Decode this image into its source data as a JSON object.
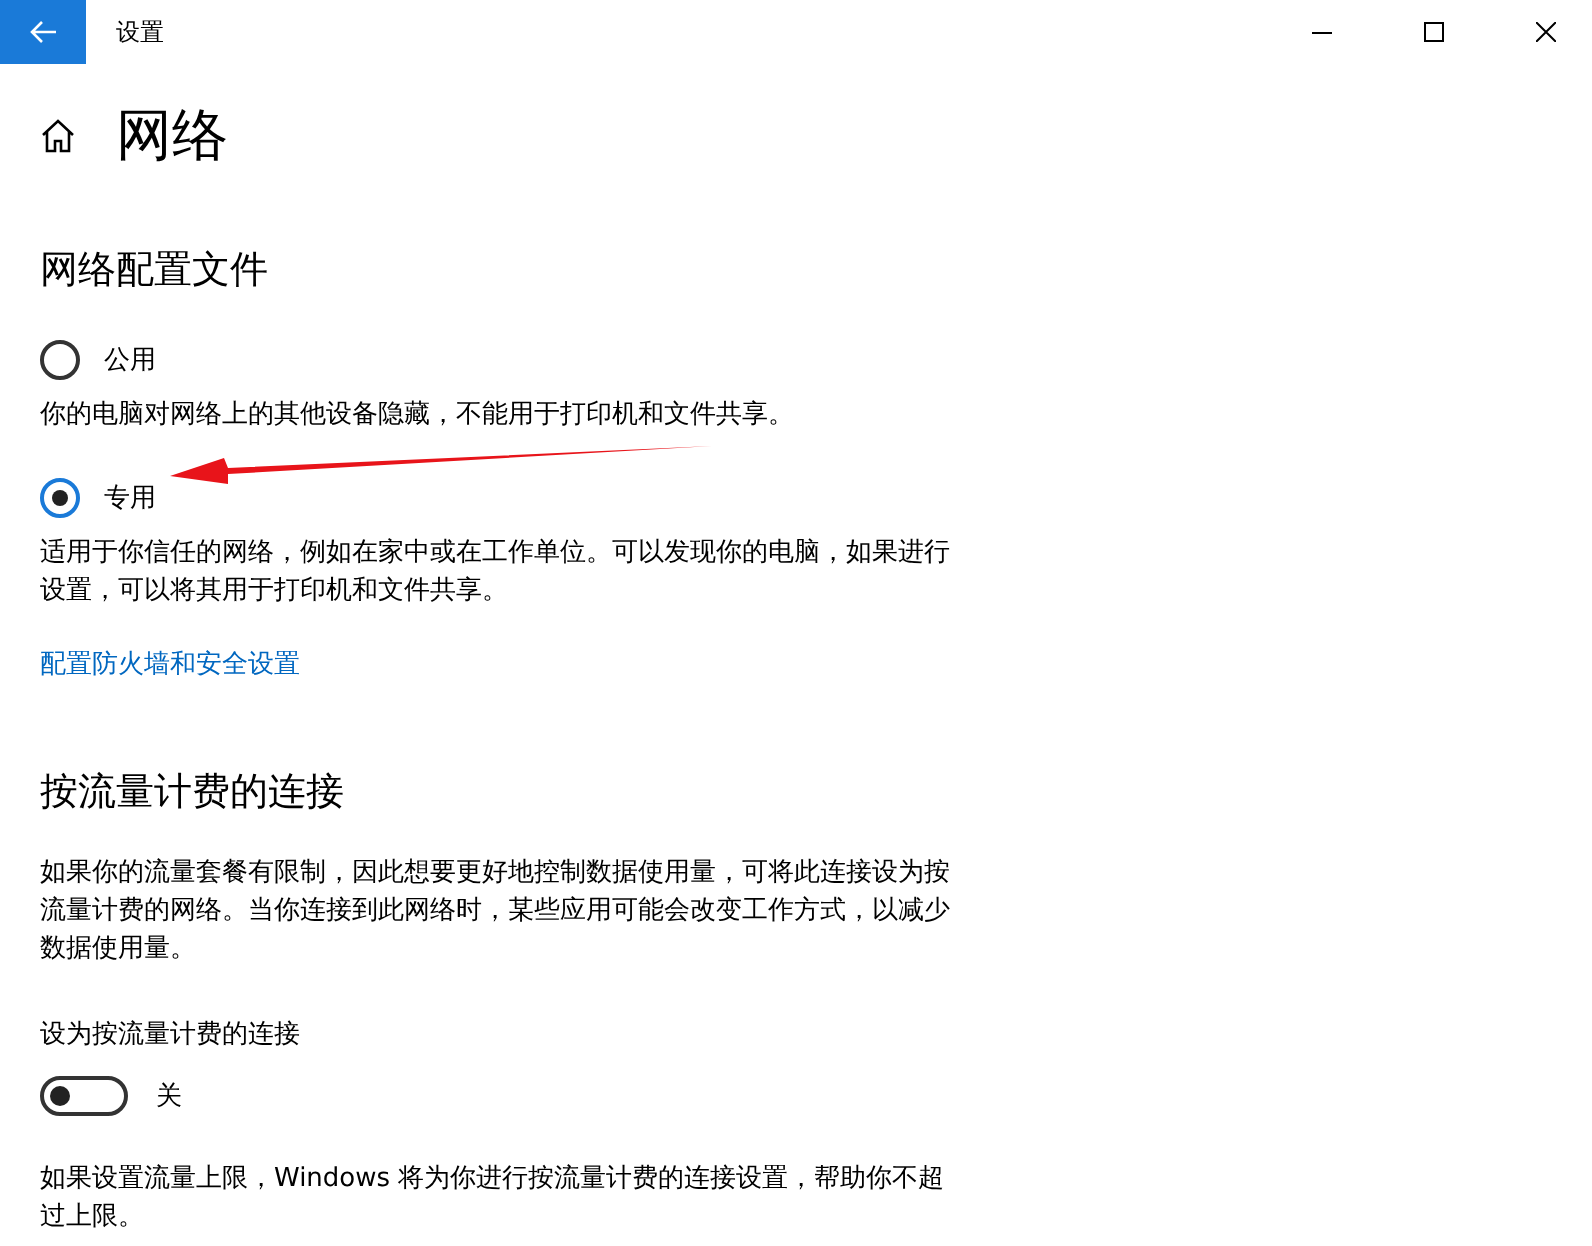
{
  "window": {
    "title": "设置"
  },
  "page": {
    "title": "网络"
  },
  "profile_section": {
    "title": "网络配置文件",
    "options": [
      {
        "label": "公用",
        "description": "你的电脑对网络上的其他设备隐藏，不能用于打印机和文件共享。",
        "selected": false
      },
      {
        "label": "专用",
        "description": "适用于你信任的网络，例如在家中或在工作单位。可以发现你的电脑，如果进行设置，可以将其用于打印机和文件共享。",
        "selected": true
      }
    ],
    "link": "配置防火墙和安全设置"
  },
  "metered_section": {
    "title": "按流量计费的连接",
    "description": "如果你的流量套餐有限制，因此想要更好地控制数据使用量，可将此连接设为按流量计费的网络。当你连接到此网络时，某些应用可能会改变工作方式，以减少数据使用量。",
    "toggle": {
      "label": "设为按流量计费的连接",
      "on": false,
      "state_text": "关"
    },
    "note": "如果设置流量上限，Windows 将为你进行按流量计费的连接设置，帮助你不超过上限。"
  }
}
